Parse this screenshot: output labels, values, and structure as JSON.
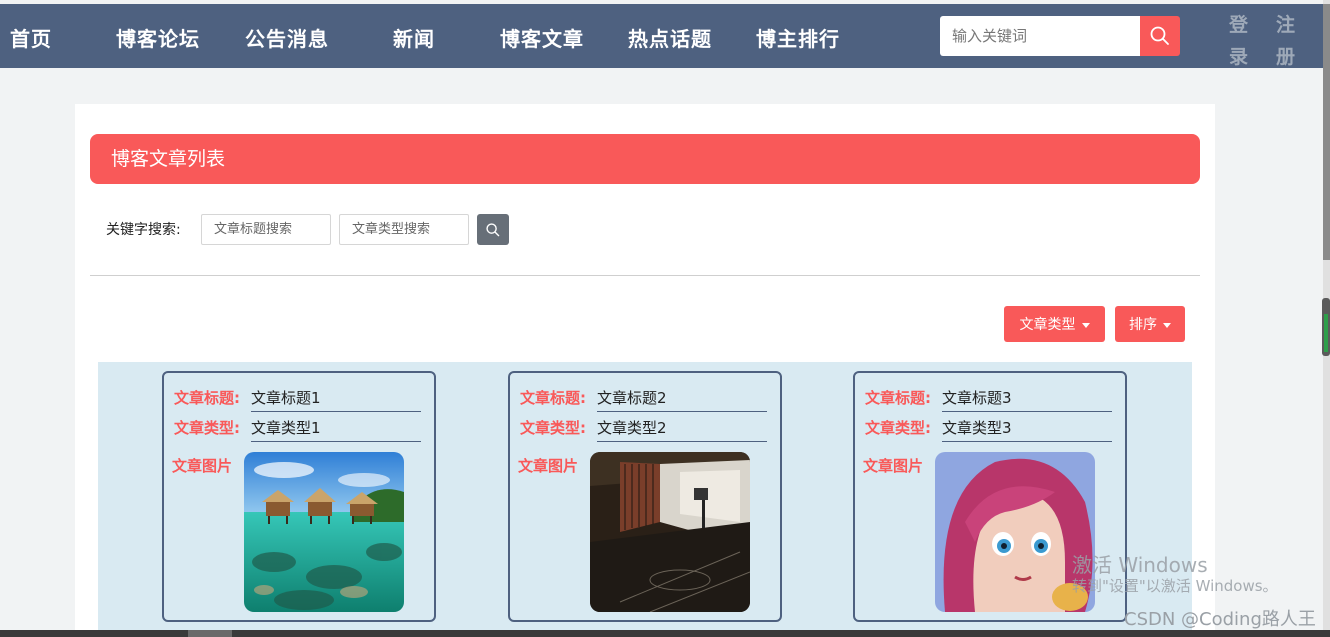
{
  "nav": {
    "items": [
      "首页",
      "博客论坛",
      "公告消息",
      "新闻",
      "博客文章",
      "热点话题",
      "博主排行"
    ],
    "search_placeholder": "输入关键词",
    "login_1": "登",
    "login_2": "录",
    "register_1": "注",
    "register_2": "册"
  },
  "panel": {
    "title": "博客文章列表",
    "keyword_label": "关键字搜索:",
    "title_search_placeholder": "文章标题搜索",
    "type_search_placeholder": "文章类型搜索",
    "type_dropdown": "文章类型",
    "sort_dropdown": "排序"
  },
  "cards": [
    {
      "title_label": "文章标题:",
      "title": "文章标题1",
      "type_label": "文章类型:",
      "type": "文章类型1",
      "image_label": "文章图片",
      "image": "tropical-lagoon-bungalows"
    },
    {
      "title_label": "文章标题:",
      "title": "文章标题2",
      "type_label": "文章类型:",
      "type": "文章类型2",
      "image_label": "文章图片",
      "image": "indoor-basketball-court"
    },
    {
      "title_label": "文章标题:",
      "title": "文章标题3",
      "type_label": "文章类型:",
      "type": "文章类型3",
      "image_label": "文章图片",
      "image": "pink-haired-anime-girl"
    }
  ],
  "watermark": {
    "line1": "激活 Windows",
    "line2": "转到\"设置\"以激活 Windows。",
    "csdn": "CSDN @Coding路人王"
  },
  "colors": {
    "nav_bg": "#4e6180",
    "accent": "#f95959",
    "grid_bg": "#d9eaf2",
    "page_bg": "#f1f3f4"
  }
}
